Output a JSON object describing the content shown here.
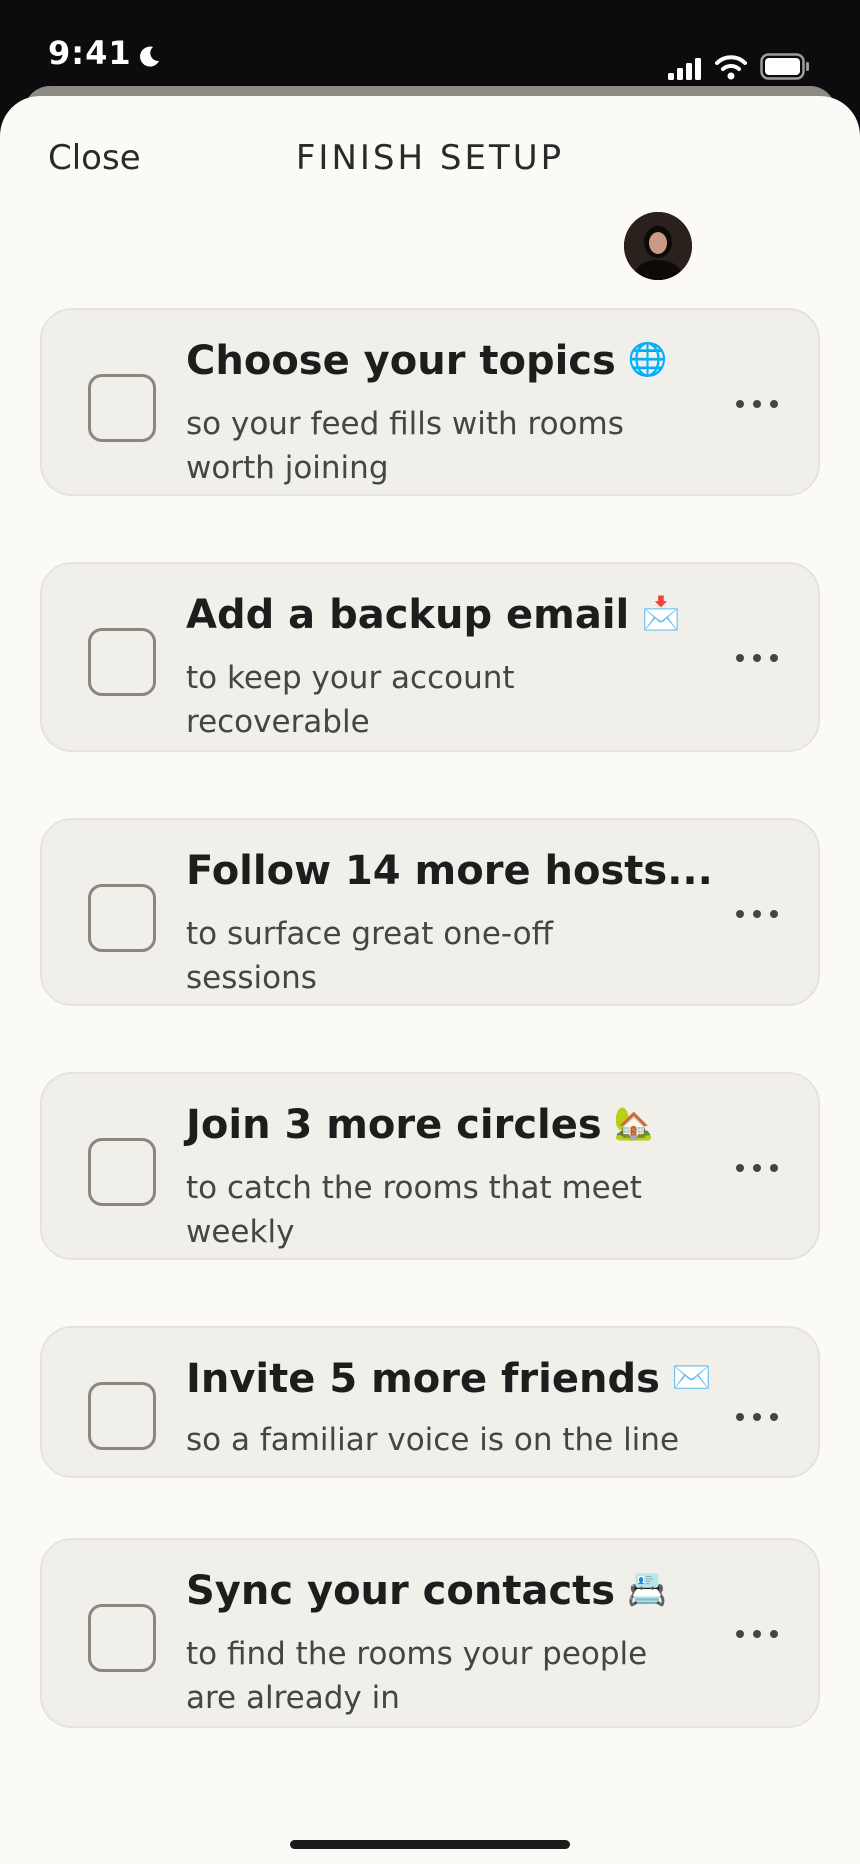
{
  "status_bar": {
    "time": "9:41"
  },
  "header": {
    "close_label": "Close",
    "title": "FINISH SETUP"
  },
  "tasks": [
    {
      "title": "Choose your topics",
      "emoji": "🌐",
      "subtitle": "so your feed fills with rooms worth joining",
      "checked": false
    },
    {
      "title": "Add a backup email",
      "emoji": "📩",
      "subtitle": "to keep your account recoverable",
      "checked": false
    },
    {
      "title": "Follow 14 more hosts...",
      "emoji": "",
      "subtitle": "to surface great one-off sessions",
      "checked": false
    },
    {
      "title": "Join 3 more circles",
      "emoji": "🏡",
      "subtitle": "to catch the rooms that meet weekly",
      "checked": false
    },
    {
      "title": "Invite 5 more friends",
      "emoji": "✉️",
      "subtitle": "so a familiar voice is on the line",
      "checked": false
    },
    {
      "title": "Sync your contacts",
      "emoji": "📇",
      "subtitle": "to find the rooms your people are already in",
      "checked": false
    }
  ],
  "icons": {
    "more": "more-icon",
    "moon": "moon-icon",
    "signal": "signal-icon",
    "wifi": "wifi-icon",
    "battery": "battery-icon"
  },
  "colors": {
    "sheet_background": "#fbfaf6",
    "card_background": "#f1efea",
    "checkbox_border": "#8a877f",
    "text_primary": "#1d1d1d"
  }
}
